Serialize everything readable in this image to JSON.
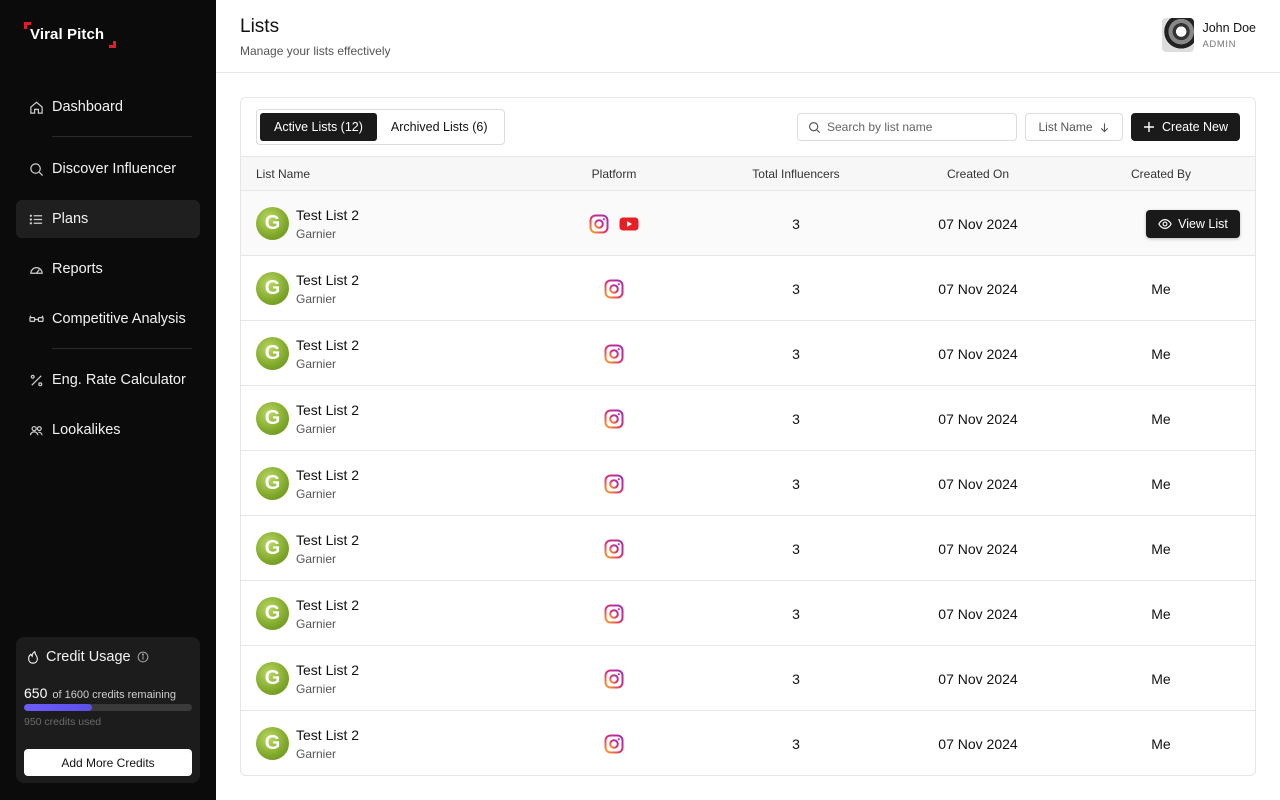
{
  "brand": {
    "name": "Viral Pitch",
    "accent": "#e11d2a"
  },
  "sidebar": {
    "items": [
      {
        "label": "Dashboard",
        "icon": "home-icon",
        "active": false
      },
      {
        "label": "Discover Influencer",
        "icon": "search-icon",
        "active": false
      },
      {
        "label": "Plans",
        "icon": "list-icon",
        "active": true
      },
      {
        "label": "Reports",
        "icon": "gauge-icon",
        "active": false
      },
      {
        "label": "Competitive Analysis",
        "icon": "glasses-icon",
        "active": false
      },
      {
        "label": "Eng. Rate Calculator",
        "icon": "percent-icon",
        "active": false
      },
      {
        "label": "Lookalikes",
        "icon": "users-icon",
        "active": false
      }
    ],
    "credits": {
      "title": "Credit Usage",
      "remaining": "650",
      "remaining_text": "of 1600 credits remaining",
      "used_text": "950 credits used",
      "progress": 0.406,
      "button": "Add More Credits"
    }
  },
  "header": {
    "title": "Lists",
    "subtitle": "Manage your lists effectively",
    "user": {
      "name": "John Doe",
      "role": "ADMIN"
    }
  },
  "toolbar": {
    "tabs": [
      {
        "label": "Active Lists (12)",
        "active": true
      },
      {
        "label": "Archived Lists (6)",
        "active": false
      }
    ],
    "search_placeholder": "Search by list name",
    "sort_label": "List Name",
    "create_label": "Create New"
  },
  "table": {
    "columns": [
      "List Name",
      "Platform",
      "Total Influencers",
      "Created On",
      "Created By"
    ],
    "view_label": "View List",
    "rows": [
      {
        "name": "Test List 2",
        "brand": "Garnier",
        "platforms": [
          "instagram",
          "youtube"
        ],
        "total": "3",
        "created_on": "07 Nov 2024",
        "created_by": "",
        "hover": true
      },
      {
        "name": "Test List 2",
        "brand": "Garnier",
        "platforms": [
          "instagram"
        ],
        "total": "3",
        "created_on": "07 Nov 2024",
        "created_by": "Me"
      },
      {
        "name": "Test List 2",
        "brand": "Garnier",
        "platforms": [
          "instagram"
        ],
        "total": "3",
        "created_on": "07 Nov 2024",
        "created_by": "Me"
      },
      {
        "name": "Test List 2",
        "brand": "Garnier",
        "platforms": [
          "instagram"
        ],
        "total": "3",
        "created_on": "07 Nov 2024",
        "created_by": "Me"
      },
      {
        "name": "Test List 2",
        "brand": "Garnier",
        "platforms": [
          "instagram"
        ],
        "total": "3",
        "created_on": "07 Nov 2024",
        "created_by": "Me"
      },
      {
        "name": "Test List 2",
        "brand": "Garnier",
        "platforms": [
          "instagram"
        ],
        "total": "3",
        "created_on": "07 Nov 2024",
        "created_by": "Me"
      },
      {
        "name": "Test List 2",
        "brand": "Garnier",
        "platforms": [
          "instagram"
        ],
        "total": "3",
        "created_on": "07 Nov 2024",
        "created_by": "Me"
      },
      {
        "name": "Test List 2",
        "brand": "Garnier",
        "platforms": [
          "instagram"
        ],
        "total": "3",
        "created_on": "07 Nov 2024",
        "created_by": "Me"
      },
      {
        "name": "Test List 2",
        "brand": "Garnier",
        "platforms": [
          "instagram"
        ],
        "total": "3",
        "created_on": "07 Nov 2024",
        "created_by": "Me"
      }
    ]
  }
}
